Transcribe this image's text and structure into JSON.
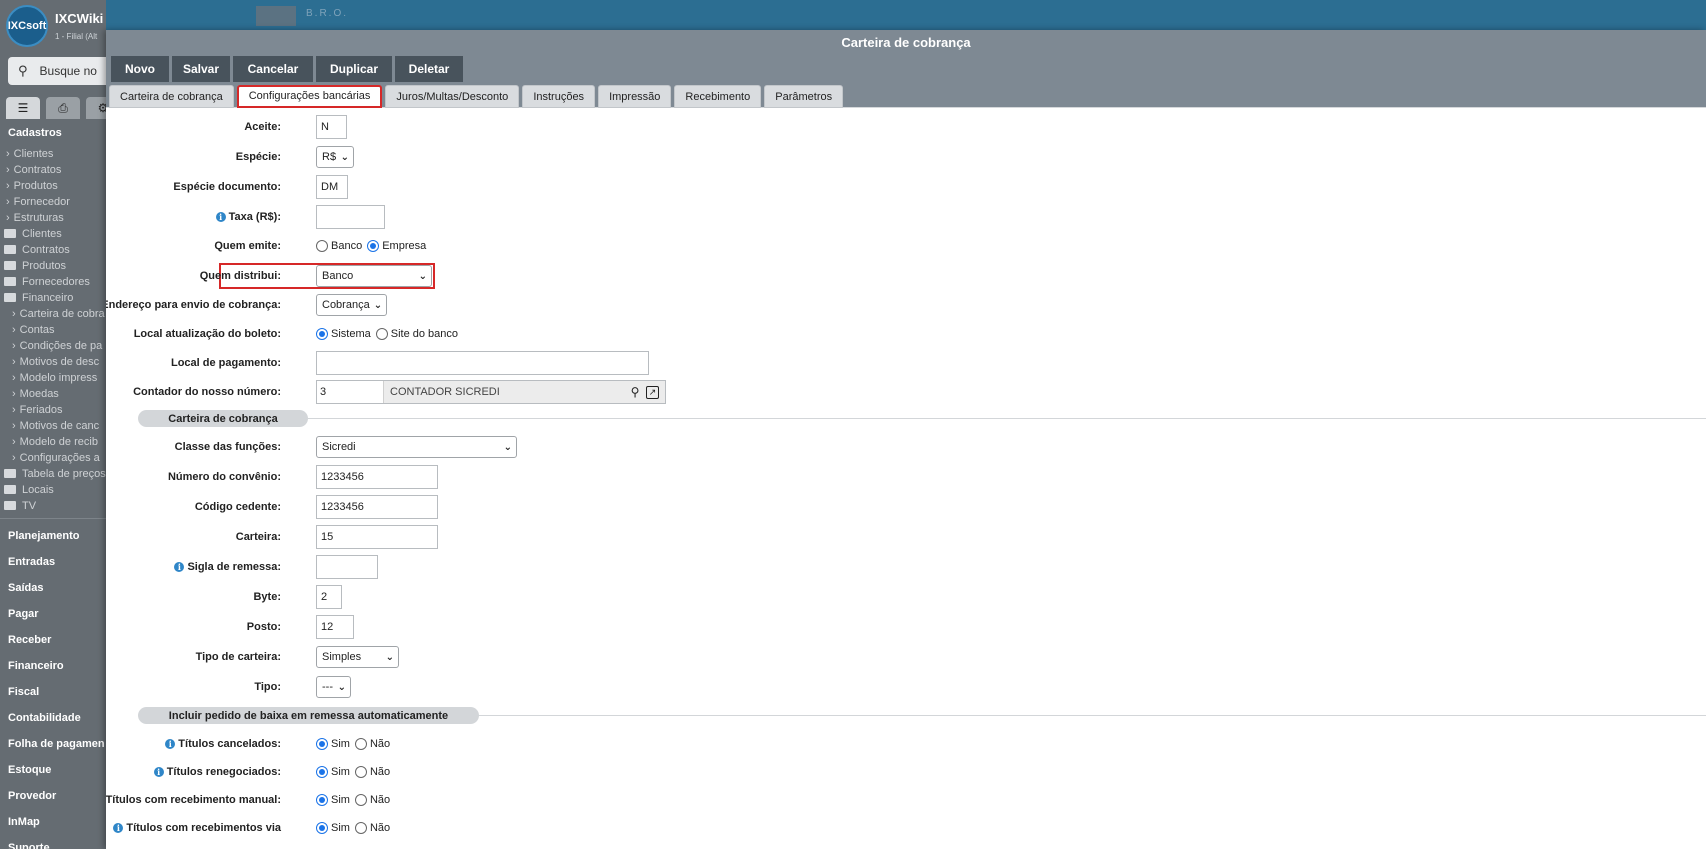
{
  "bg_app": {
    "logo_text": "IXCsoft",
    "title": "IXCWiki",
    "subtitle": "1 - Filial (Alt",
    "search_placeholder": "Busque no",
    "header_text": "B.R.O.",
    "sidebar": {
      "section_title": "Cadastros",
      "items": [
        {
          "type": "link",
          "label": "Clientes"
        },
        {
          "type": "link",
          "label": "Contratos"
        },
        {
          "type": "link",
          "label": "Produtos"
        },
        {
          "type": "link",
          "label": "Fornecedor"
        },
        {
          "type": "link",
          "label": "Estruturas"
        },
        {
          "type": "folder",
          "label": "Clientes"
        },
        {
          "type": "folder",
          "label": "Contratos"
        },
        {
          "type": "folder",
          "label": "Produtos"
        },
        {
          "type": "folder",
          "label": "Fornecedores"
        },
        {
          "type": "folder-open",
          "label": "Financeiro"
        },
        {
          "type": "sub",
          "label": "Carteira de cobra"
        },
        {
          "type": "sub",
          "label": "Contas"
        },
        {
          "type": "sub",
          "label": "Condições de pa"
        },
        {
          "type": "sub",
          "label": "Motivos de desc"
        },
        {
          "type": "sub",
          "label": "Modelo impress"
        },
        {
          "type": "sub",
          "label": "Moedas"
        },
        {
          "type": "sub",
          "label": "Feriados"
        },
        {
          "type": "sub",
          "label": "Motivos de canc"
        },
        {
          "type": "sub",
          "label": "Modelo de recib"
        },
        {
          "type": "sub",
          "label": "Configurações a"
        },
        {
          "type": "folder",
          "label": "Tabela de preços"
        },
        {
          "type": "folder",
          "label": "Locais"
        },
        {
          "type": "folder",
          "label": "TV"
        }
      ],
      "modules": [
        "Planejamento",
        "Entradas",
        "Saídas",
        "Pagar",
        "Receber",
        "Financeiro",
        "Fiscal",
        "Contabilidade",
        "Folha de pagamen",
        "Estoque",
        "Provedor",
        "InMap",
        "Suporte"
      ]
    }
  },
  "modal": {
    "title": "Carteira de cobrança",
    "toolbar": {
      "novo": "Novo",
      "salvar": "Salvar",
      "cancelar": "Cancelar",
      "duplicar": "Duplicar",
      "deletar": "Deletar"
    },
    "tabs": [
      {
        "label": "Carteira de cobrança",
        "active": false
      },
      {
        "label": "Configurações bancárias",
        "active": true
      },
      {
        "label": "Juros/Multas/Desconto",
        "active": false
      },
      {
        "label": "Instruções",
        "active": false
      },
      {
        "label": "Impressão",
        "active": false
      },
      {
        "label": "Recebimento",
        "active": false
      },
      {
        "label": "Parâmetros",
        "active": false
      }
    ],
    "form": {
      "aceite": {
        "label": "Aceite:",
        "value": "N"
      },
      "especie": {
        "label": "Espécie:",
        "value": "R$"
      },
      "especie_documento": {
        "label": "Espécie documento:",
        "value": "DM"
      },
      "taxa": {
        "label": "Taxa (R$):",
        "value": ""
      },
      "quem_emite": {
        "label": "Quem emite:",
        "opt1": "Banco",
        "opt2": "Empresa",
        "selected": "Empresa"
      },
      "quem_distribui": {
        "label": "Quem distribui:",
        "value": "Banco"
      },
      "endereco": {
        "label": "Endereço para envio de cobrança:",
        "value": "Cobrança"
      },
      "local_atualizacao": {
        "label": "Local atualização do boleto:",
        "opt1": "Sistema",
        "opt2": "Site do banco",
        "selected": "Sistema"
      },
      "local_pagamento": {
        "label": "Local de pagamento:",
        "value": ""
      },
      "contador": {
        "label": "Contador do nosso número:",
        "value": "3",
        "name": "CONTADOR SICREDI"
      },
      "section1": "Carteira de cobrança",
      "classe_funcoes": {
        "label": "Classe das funções:",
        "value": "Sicredi"
      },
      "numero_convenio": {
        "label": "Número do convênio:",
        "value": "1233456"
      },
      "codigo_cedente": {
        "label": "Código cedente:",
        "value": "1233456"
      },
      "carteira": {
        "label": "Carteira:",
        "value": "15"
      },
      "sigla_remessa": {
        "label": "Sigla de remessa:",
        "value": ""
      },
      "byte": {
        "label": "Byte:",
        "value": "2"
      },
      "posto": {
        "label": "Posto:",
        "value": "12"
      },
      "tipo_carteira": {
        "label": "Tipo de carteira:",
        "value": "Simples"
      },
      "tipo": {
        "label": "Tipo:",
        "value": "---"
      },
      "section2": "Incluir pedido de baixa em remessa automaticamente",
      "titulos_cancelados": {
        "label": "Títulos cancelados:",
        "opt1": "Sim",
        "opt2": "Não",
        "selected": "Sim"
      },
      "titulos_renegociados": {
        "label": "Títulos renegociados:",
        "opt1": "Sim",
        "opt2": "Não",
        "selected": "Sim"
      },
      "titulos_manual": {
        "label": "Títulos com recebimento manual:",
        "opt1": "Sim",
        "opt2": "Não",
        "selected": "Sim"
      },
      "titulos_via": {
        "label": "Títulos com recebimentos via",
        "opt1": "Sim",
        "opt2": "Não",
        "selected": "Sim"
      }
    }
  }
}
